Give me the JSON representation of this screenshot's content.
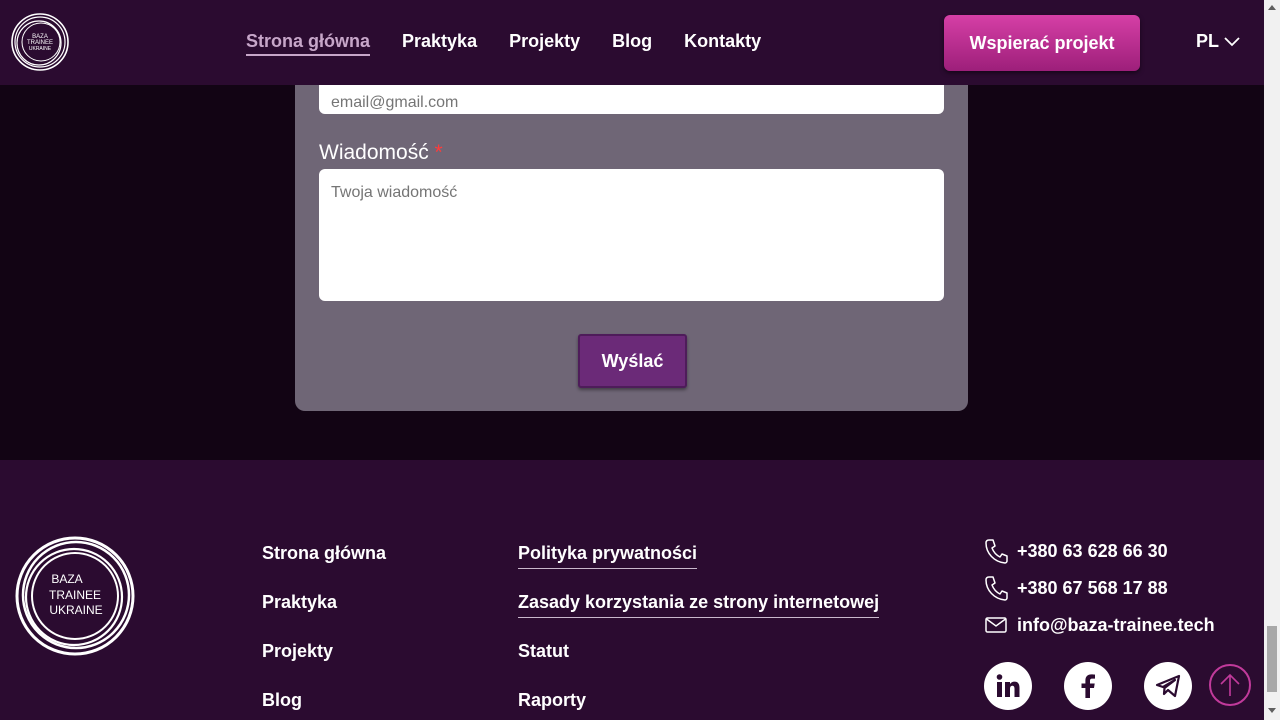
{
  "header": {
    "nav": [
      "Strona główna",
      "Praktyka",
      "Projekty",
      "Blog",
      "Kontakty"
    ],
    "cta": "Wspierać projekt",
    "lang": "PL"
  },
  "logo": {
    "line1": "BAZA",
    "line2": "TRAINEE",
    "line3": "UKRAINE"
  },
  "form": {
    "email_placeholder": "email@gmail.com",
    "message_label": "Wiadomość",
    "required_mark": "*",
    "message_placeholder": "Twoja wiadomość",
    "submit": "Wyślać"
  },
  "footer": {
    "col1": [
      "Strona główna",
      "Praktyka",
      "Projekty",
      "Blog"
    ],
    "col2": [
      "Polityka prywatności",
      "Zasady korzystania ze strony internetowej",
      "Statut",
      "Raporty"
    ],
    "phones": [
      "+380 63 628 66 30",
      "+380 67 568 17 88"
    ],
    "email": "info@baza-trainee.tech"
  },
  "icons": {
    "socials": [
      "linkedin-icon",
      "facebook-icon",
      "telegram-icon"
    ],
    "scroll_top": "arrow-up-icon"
  },
  "colors": {
    "header_bg": "#2b0b30",
    "accent": "#d63fa6",
    "card_bg": "#6f6676"
  }
}
